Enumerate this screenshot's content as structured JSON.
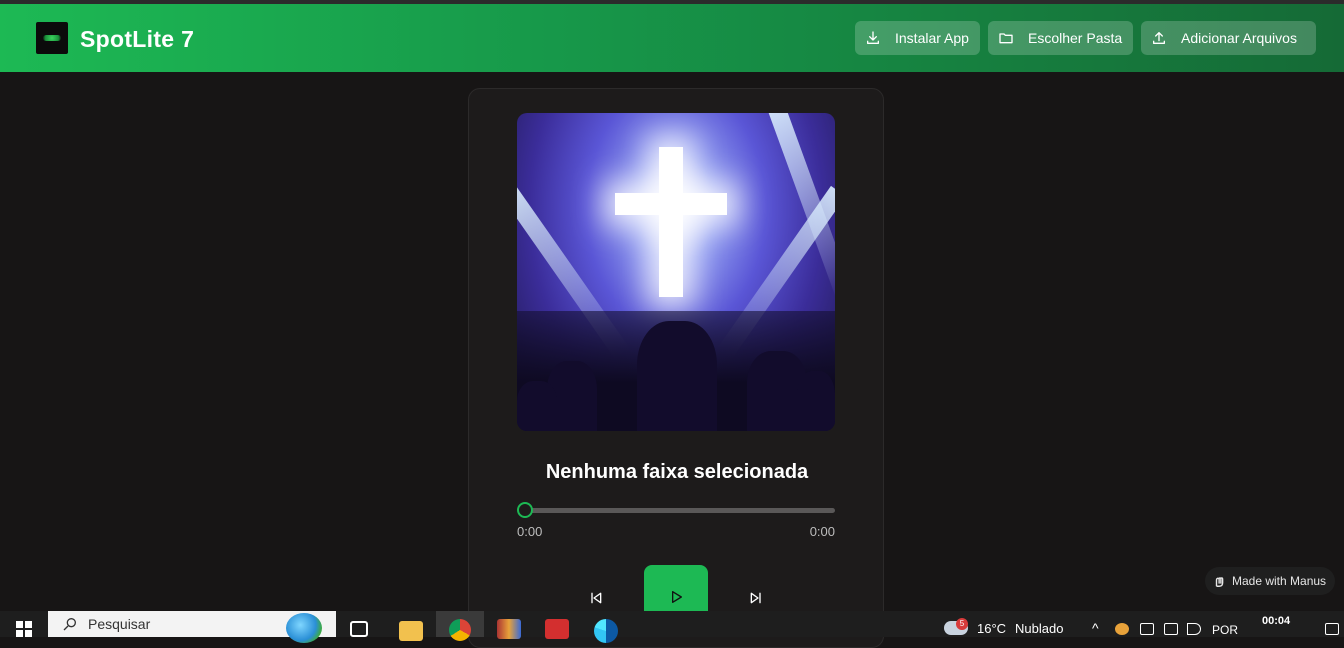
{
  "app": {
    "title": "SpotLite 7",
    "buttons": {
      "install": "Instalar App",
      "choose_folder": "Escolher Pasta",
      "add_files": "Adicionar Arquivos"
    }
  },
  "player": {
    "track_title": "Nenhuma faixa selecionada",
    "current_time": "0:00",
    "duration": "0:00",
    "progress": 0
  },
  "badge": {
    "label": "Made with Manus"
  },
  "taskbar": {
    "search_placeholder": "Pesquisar",
    "weather_temp": "16°C",
    "weather_text": "Nublado",
    "weather_badge": "5",
    "language": "POR",
    "time": "00:04"
  },
  "colors": {
    "accent": "#1db954",
    "background": "#171515",
    "card": "#1d1b1b"
  }
}
